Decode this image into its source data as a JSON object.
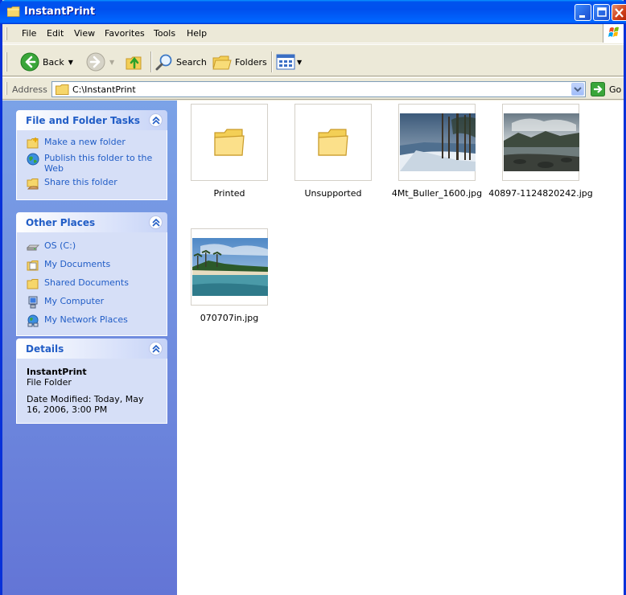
{
  "window": {
    "title": "InstantPrint"
  },
  "menu": {
    "items": [
      "File",
      "Edit",
      "View",
      "Favorites",
      "Tools",
      "Help"
    ]
  },
  "toolbar": {
    "back_label": "Back",
    "search_label": "Search",
    "folders_label": "Folders"
  },
  "address": {
    "label": "Address",
    "value": "C:\\InstantPrint",
    "go_label": "Go"
  },
  "tasks": {
    "file_folder": {
      "title": "File and Folder Tasks",
      "items": [
        "Make a new folder",
        "Publish this folder to the Web",
        "Share this folder"
      ]
    },
    "other_places": {
      "title": "Other Places",
      "items": [
        "OS (C:)",
        "My Documents",
        "Shared Documents",
        "My Computer",
        "My Network Places"
      ]
    },
    "details": {
      "title": "Details",
      "name": "InstantPrint",
      "type": "File Folder",
      "date_modified": "Date Modified: Today, May 16, 2006, 3:00 PM"
    }
  },
  "files": [
    {
      "name": "Printed",
      "kind": "folder"
    },
    {
      "name": "Unsupported",
      "kind": "folder"
    },
    {
      "name": "4Mt_Buller_1600.jpg",
      "kind": "image"
    },
    {
      "name": "40897-1124820242.jpg",
      "kind": "image"
    },
    {
      "name": "070707in.jpg",
      "kind": "image"
    }
  ],
  "colors": {
    "title_bar": "#0053ee",
    "task_link": "#215dc6",
    "panel_top": "#7ba2e7",
    "panel_bottom": "#6375d6"
  }
}
